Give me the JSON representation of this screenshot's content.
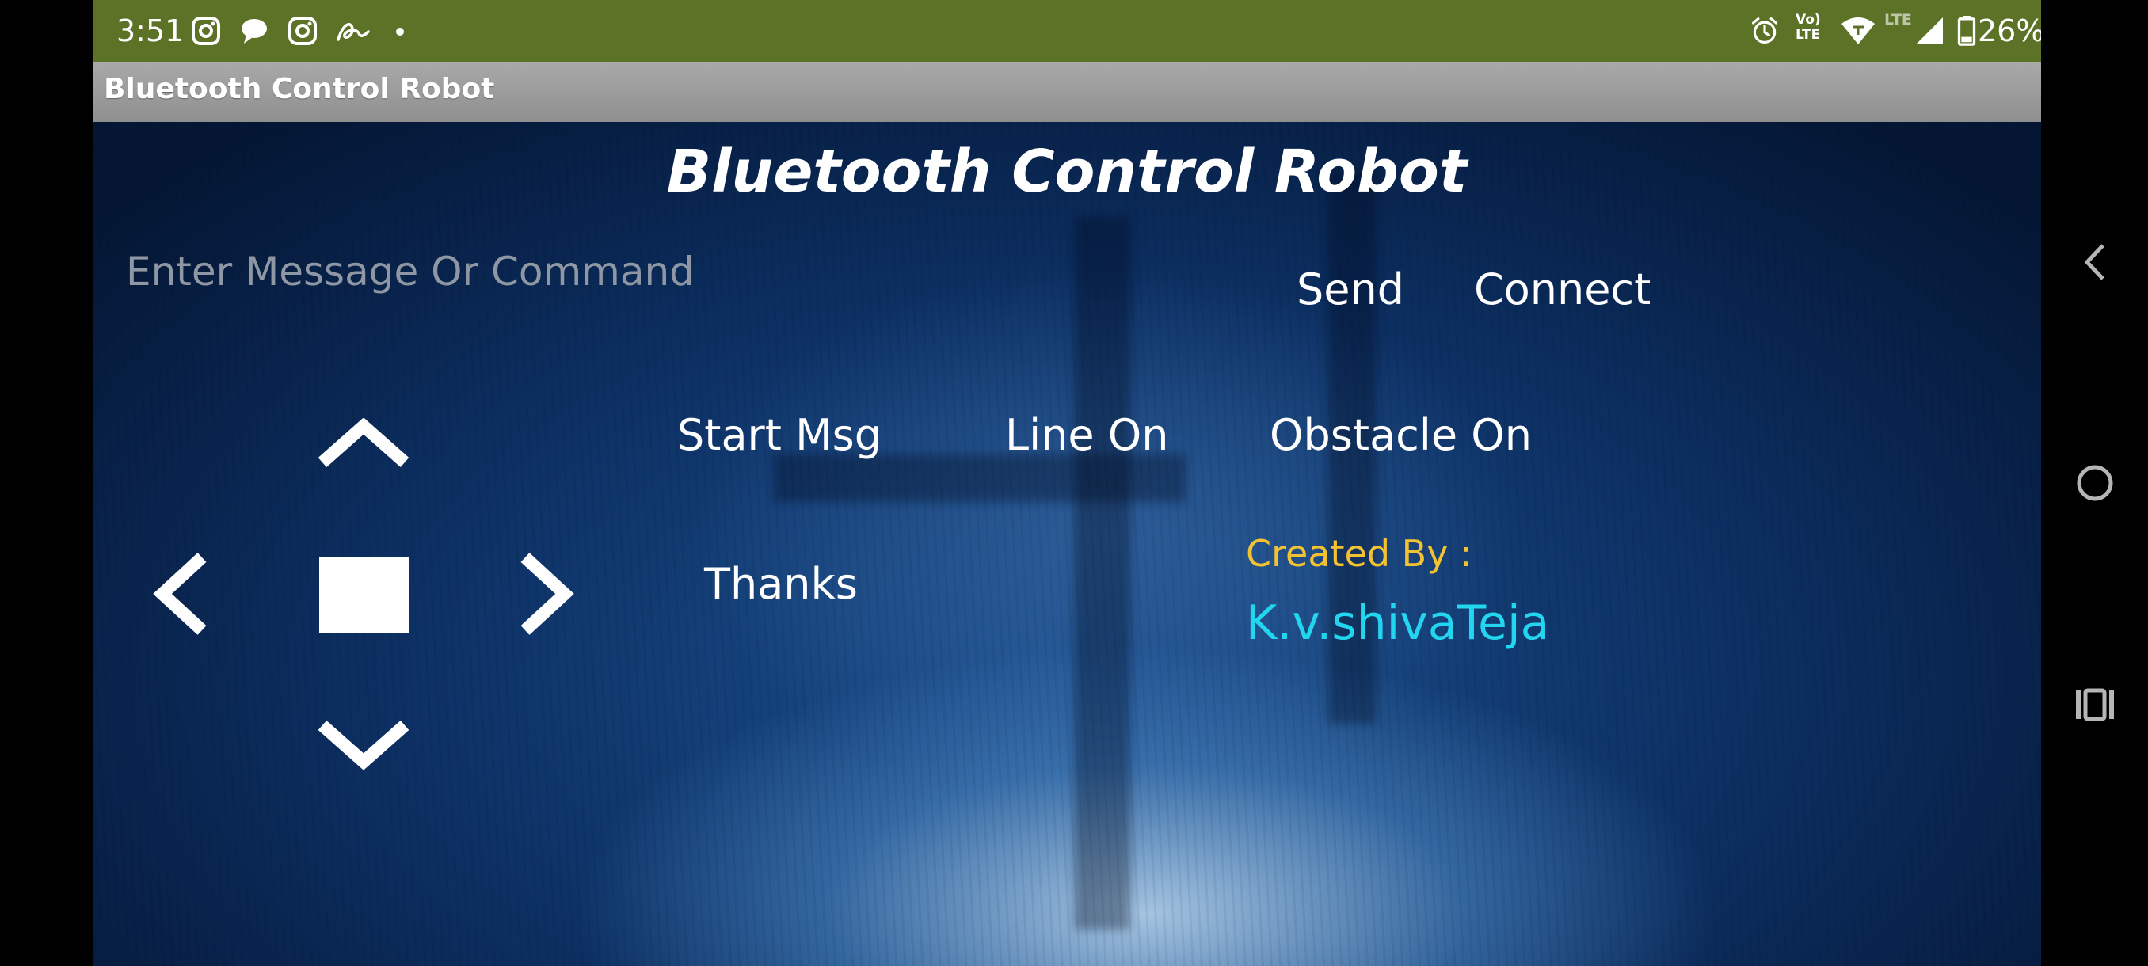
{
  "status_bar": {
    "time": "3:51",
    "notification_icons": [
      "instagram-icon",
      "chat-bubble-icon",
      "instagram-icon",
      "signature-icon",
      "dot-icon"
    ],
    "right_icons": [
      "alarm-icon",
      "volte-icon",
      "wifi-icon",
      "lte-icon",
      "signal-icon",
      "battery-icon"
    ],
    "volte_label": "Vo) LTE",
    "lte_label": "LTE",
    "battery": "26%",
    "bar_color": "#5c7226"
  },
  "title_bar": {
    "title": "Bluetooth Control Robot"
  },
  "main": {
    "heading": "Bluetooth Control Robot",
    "message_input": {
      "placeholder": "Enter Message Or Command",
      "value": ""
    },
    "send_label": "Send",
    "connect_label": "Connect",
    "start_msg_label": "Start Msg",
    "line_on_label": "Line On",
    "obstacle_on_label": "Obstacle On",
    "thanks_label": "Thanks",
    "created_by_label": "Created By :",
    "author": "K.v.shivaTeja",
    "direction_pad": [
      "up-arrow-icon",
      "left-arrow-icon",
      "stop-square-icon",
      "right-arrow-icon",
      "down-arrow-icon"
    ],
    "colors": {
      "created_by": "#f2c230",
      "author": "#22d6f0",
      "background": "#0c2f62"
    }
  },
  "nav_bar": {
    "items": [
      "back-icon",
      "home-icon",
      "recents-icon"
    ]
  }
}
